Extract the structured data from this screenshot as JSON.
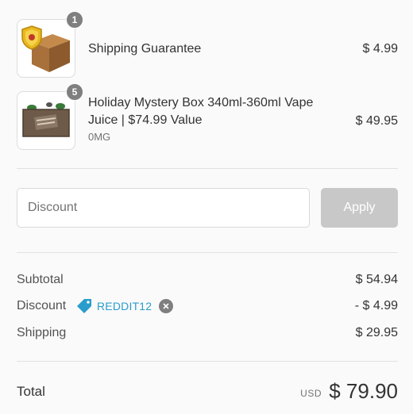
{
  "products": [
    {
      "name": "Shipping Guarantee",
      "variant": "",
      "quantity": "1",
      "price": "$ 4.99",
      "image_icon": "shield-box-icon"
    },
    {
      "name": "Holiday Mystery Box 340ml-360ml Vape Juice | $74.99 Value",
      "variant": "0MG",
      "quantity": "5",
      "price": "$ 49.95",
      "image_icon": "mystery-box-icon"
    }
  ],
  "discount_form": {
    "placeholder": "Discount",
    "value": "",
    "apply_label": "Apply"
  },
  "summary": {
    "subtotal_label": "Subtotal",
    "subtotal_value": "$ 54.94",
    "discount_label": "Discount",
    "discount_code": "REDDIT12",
    "discount_value": "- $ 4.99",
    "shipping_label": "Shipping",
    "shipping_value": "$ 29.95"
  },
  "total": {
    "label": "Total",
    "currency": "USD",
    "value": "$ 79.90"
  },
  "colors": {
    "background": "#fafafa",
    "accent": "#2a9dcc",
    "badge": "#7f7f7f",
    "button_disabled": "#c8c8c8"
  }
}
